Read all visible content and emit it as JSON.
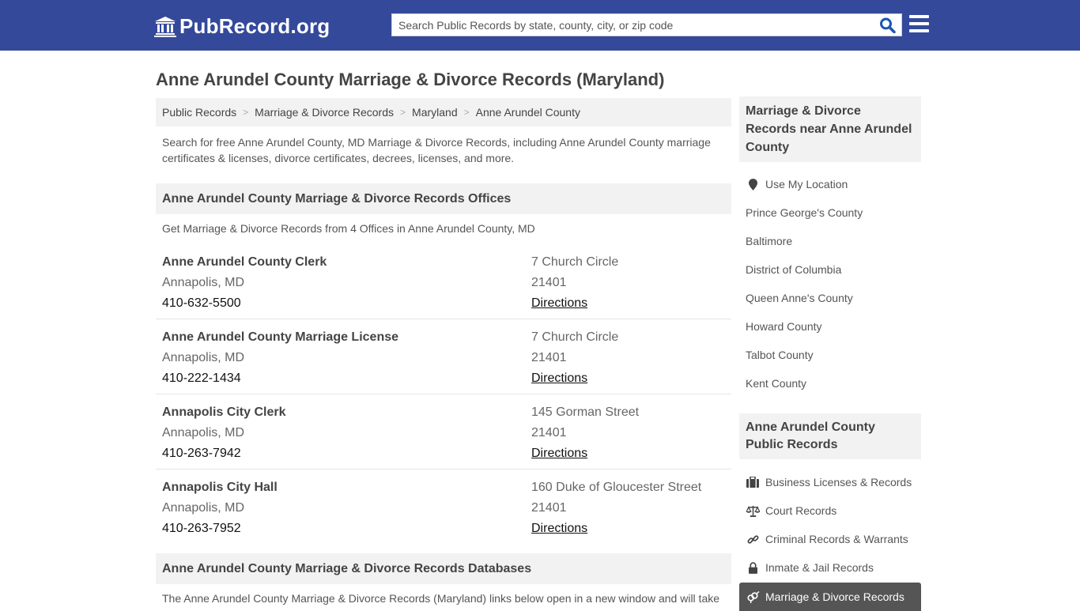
{
  "header": {
    "logo_text": "PubRecord.org",
    "search_placeholder": "Search Public Records by state, county, city, or zip code",
    "colors": {
      "bar": "#34499a",
      "accent": "#1c56b0"
    },
    "search_icon": "magnifier-icon",
    "menu_icon": "hamburger-menu-icon"
  },
  "page": {
    "title": "Anne Arundel County Marriage & Divorce Records (Maryland)",
    "breadcrumb": [
      "Public Records",
      "Marriage & Divorce Records",
      "Maryland",
      "Anne Arundel County"
    ],
    "intro": "Search for free Anne Arundel County, MD Marriage & Divorce Records, including Anne Arundel County marriage certificates & licenses, divorce certificates, decrees, licenses, and more."
  },
  "offices": {
    "heading": "Anne Arundel County Marriage & Divorce Records Offices",
    "subheading": "Get Marriage & Divorce Records from 4 Offices in Anne Arundel County, MD",
    "items": [
      {
        "name": "Anne Arundel County Clerk",
        "city": "Annapolis, MD",
        "phone": "410-632-5500",
        "address": "7 Church Circle",
        "zip": "21401",
        "directions": "Directions"
      },
      {
        "name": "Anne Arundel County Marriage License",
        "city": "Annapolis, MD",
        "phone": "410-222-1434",
        "address": "7 Church Circle",
        "zip": "21401",
        "directions": "Directions"
      },
      {
        "name": "Annapolis City Clerk",
        "city": "Annapolis, MD",
        "phone": "410-263-7942",
        "address": "145 Gorman Street",
        "zip": "21401",
        "directions": "Directions"
      },
      {
        "name": "Annapolis City Hall",
        "city": "Annapolis, MD",
        "phone": "410-263-7952",
        "address": "160 Duke of Gloucester Street",
        "zip": "21401",
        "directions": "Directions"
      }
    ]
  },
  "databases": {
    "heading": "Anne Arundel County Marriage & Divorce Records Databases",
    "text": "The Anne Arundel County Marriage & Divorce Records (Maryland) links below open in a new window and will take"
  },
  "sidebar": {
    "nearby_heading": "Marriage & Divorce Records near Anne Arundel County",
    "use_location": "Use My Location",
    "nearby": [
      "Prince George's County",
      "Baltimore",
      "District of Columbia",
      "Queen Anne's County",
      "Howard County",
      "Talbot County",
      "Kent County"
    ],
    "public_heading": "Anne Arundel County Public Records",
    "public_links": [
      {
        "label": "Business Licenses & Records",
        "icon": "briefcase-icon"
      },
      {
        "label": "Court Records",
        "icon": "scales-icon"
      },
      {
        "label": "Criminal Records & Warrants",
        "icon": "link-icon"
      },
      {
        "label": "Inmate & Jail Records",
        "icon": "lock-icon"
      }
    ],
    "active_link": {
      "label": "Marriage & Divorce Records",
      "icon": "gender-rings-icon"
    }
  }
}
